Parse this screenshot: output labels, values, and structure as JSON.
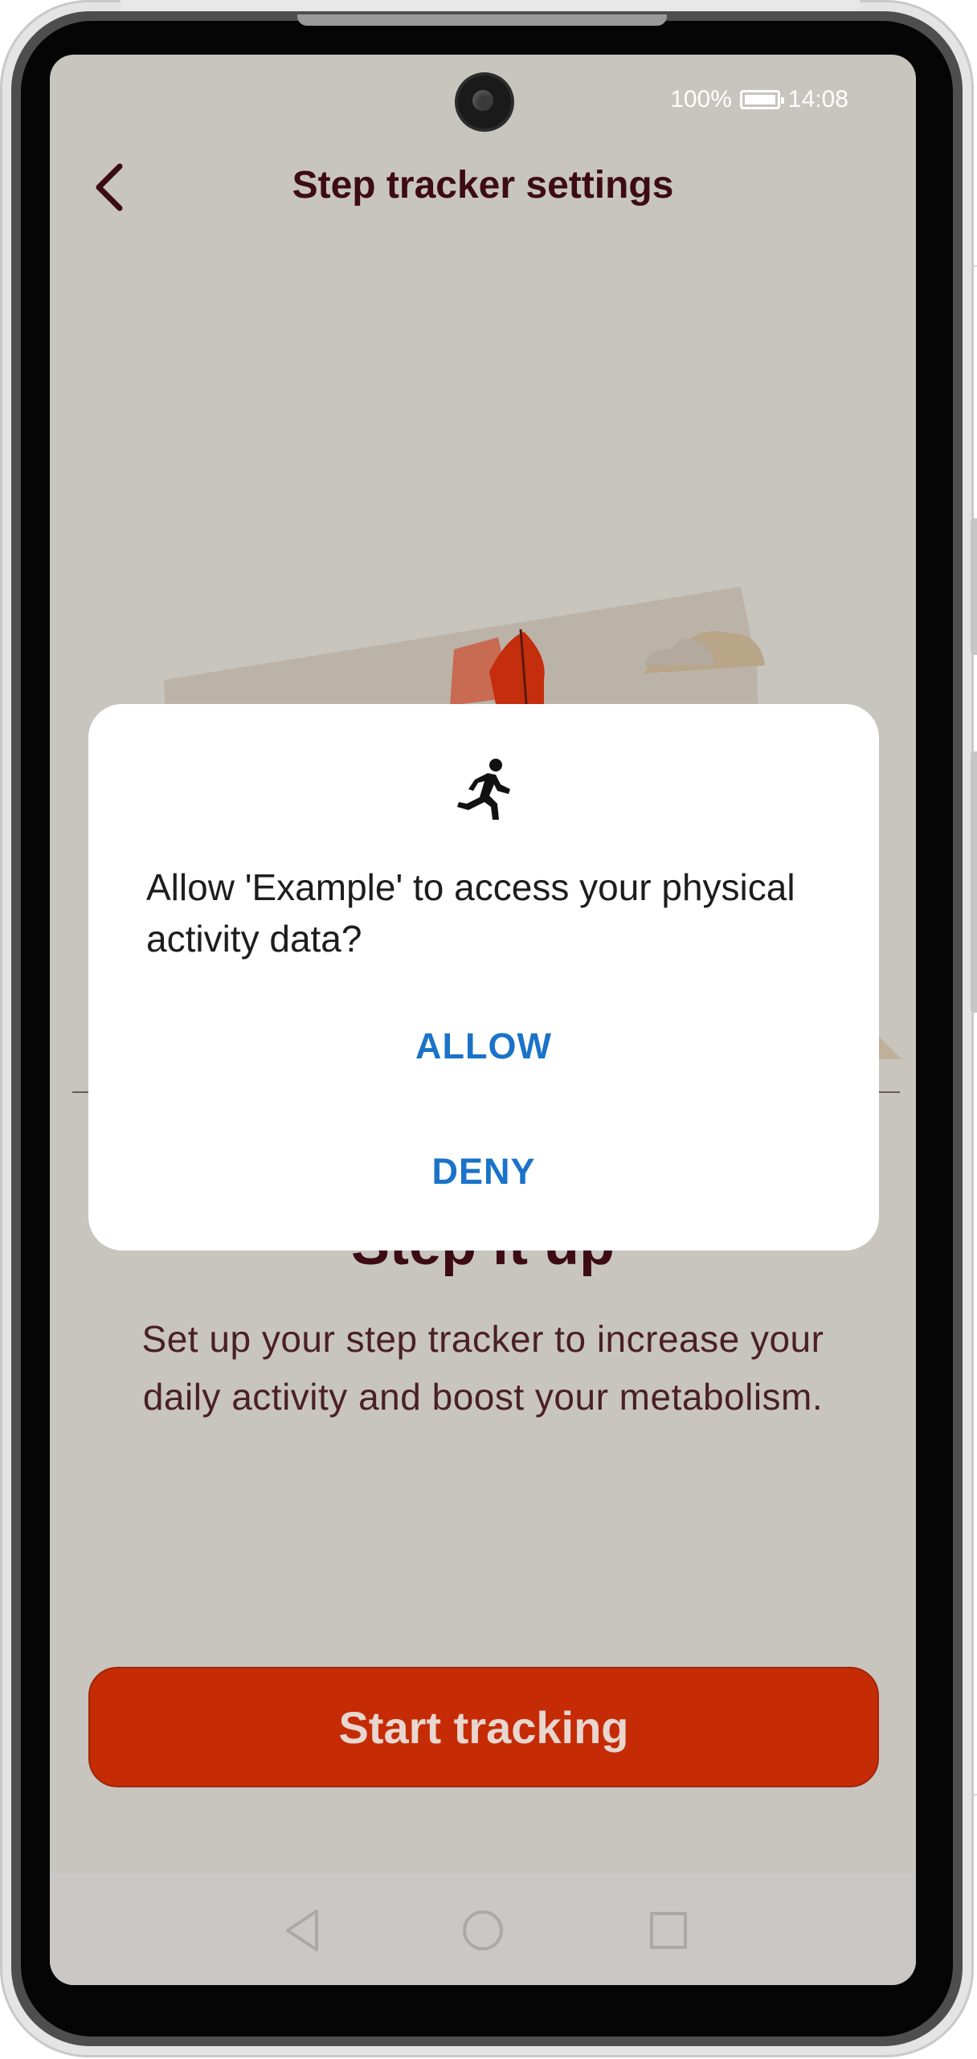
{
  "status_bar": {
    "battery_percent": "100%",
    "battery_icon": "battery-charging-icon",
    "time": "14:08"
  },
  "header": {
    "back_icon": "chevron-left-icon",
    "title": "Step tracker settings"
  },
  "hero": {
    "heading": "Step it up",
    "description": "Set up your step tracker to increase your daily activity and boost your metabolism."
  },
  "start_button": {
    "label": "Start tracking"
  },
  "permission_dialog": {
    "icon": "running-person-icon",
    "message": "Allow 'Example' to access your physical activity data?",
    "allow_label": "ALLOW",
    "deny_label": "DENY"
  },
  "nav_bar": {
    "back_icon": "triangle-back-icon",
    "home_icon": "circle-home-icon",
    "recents_icon": "square-recents-icon"
  },
  "colors": {
    "screen_background": "#c8c5bf",
    "primary_text": "#3d0b16",
    "accent_button": "#c52c06",
    "dialog_action": "#1a73c8"
  }
}
